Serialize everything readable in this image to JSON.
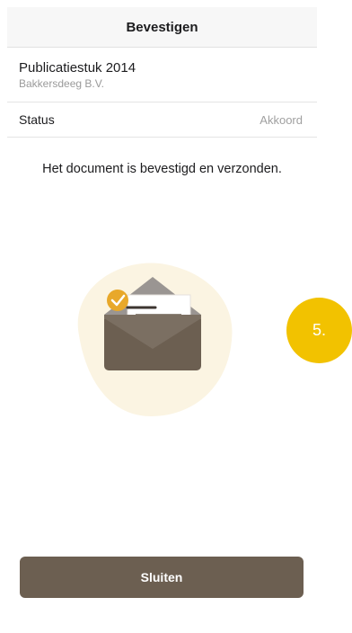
{
  "header": {
    "title": "Bevestigen"
  },
  "document": {
    "title": "Publicatiestuk 2014",
    "company": "Bakkersdeeg B.V."
  },
  "status": {
    "label": "Status",
    "value": "Akkoord"
  },
  "confirmation": {
    "message": "Het document is bevestigd en verzonden."
  },
  "actions": {
    "close_label": "Sluiten"
  },
  "step_badge": {
    "label": "5."
  },
  "colors": {
    "primary_button": "#6c5f51",
    "badge": "#f2c200",
    "check_badge": "#e8a82a",
    "envelope": "#6c5f51",
    "blob_background": "#fbf4e2"
  },
  "illustration": {
    "icon": "envelope-check-icon"
  }
}
